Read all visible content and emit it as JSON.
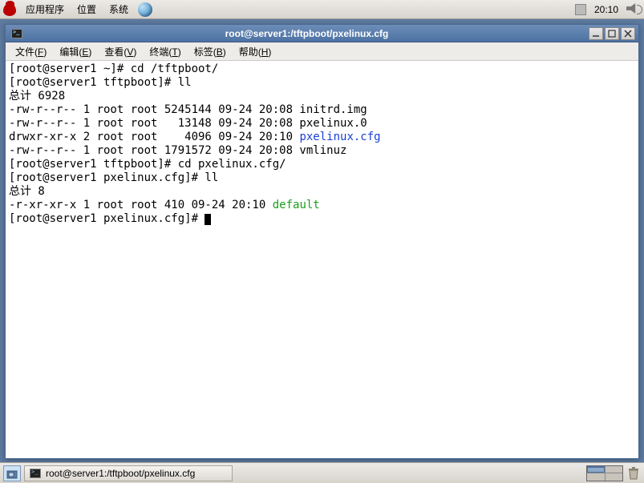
{
  "topbar": {
    "menus": [
      "应用程序",
      "位置",
      "系统"
    ],
    "clock": "20:10"
  },
  "window": {
    "title": "root@server1:/tftpboot/pxelinux.cfg",
    "menus": [
      {
        "label": "文件",
        "key": "F"
      },
      {
        "label": "编辑",
        "key": "E"
      },
      {
        "label": "查看",
        "key": "V"
      },
      {
        "label": "终端",
        "key": "T"
      },
      {
        "label": "标签",
        "key": "B"
      },
      {
        "label": "帮助",
        "key": "H"
      }
    ]
  },
  "terminal": {
    "lines": [
      {
        "t": "[root@server1 ~]# cd /tftpboot/"
      },
      {
        "t": "[root@server1 tftpboot]# ll"
      },
      {
        "t": "总计 6928"
      },
      {
        "t": "-rw-r--r-- 1 root root 5245144 09-24 20:08 initrd.img"
      },
      {
        "t": "-rw-r--r-- 1 root root   13148 09-24 20:08 pxelinux.0"
      },
      {
        "pre": "drwxr-xr-x 2 root root    4096 09-24 20:10 ",
        "cls": "dir",
        "name": "pxelinux.cfg"
      },
      {
        "t": "-rw-r--r-- 1 root root 1791572 09-24 20:08 vmlinuz"
      },
      {
        "t": "[root@server1 tftpboot]# cd pxelinux.cfg/"
      },
      {
        "t": "[root@server1 pxelinux.cfg]# ll"
      },
      {
        "t": "总计 8"
      },
      {
        "pre": "-r-xr-xr-x 1 root root 410 09-24 20:10 ",
        "cls": "exec",
        "name": "default"
      },
      {
        "prompt": "[root@server1 pxelinux.cfg]# ",
        "cursor": true
      }
    ]
  },
  "taskbar": {
    "task_label": "root@server1:/tftpboot/pxelinux.cfg"
  }
}
